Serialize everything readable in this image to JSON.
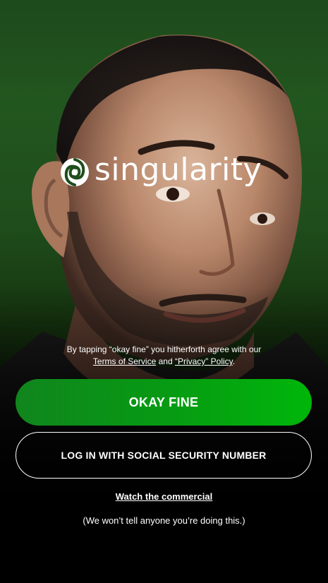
{
  "brand": {
    "name": "singularity"
  },
  "consent": {
    "prefix": "By tapping “okay fine” you hitherforth agree with our",
    "terms_link": "Terms of Service",
    "conjunction": "and",
    "privacy_link": "“Privacy” Policy",
    "suffix": "."
  },
  "actions": {
    "primary_label": "OKAY FINE",
    "secondary_label": "LOG IN WITH SOCIAL SECURITY NUMBER",
    "watch_label": "Watch the commercial",
    "tagline": "(We won’t tell anyone you’re doing this.)"
  },
  "colors": {
    "primary_button_start": "#10851d",
    "primary_button_end": "#00b60a",
    "background_green": "#22561f"
  }
}
